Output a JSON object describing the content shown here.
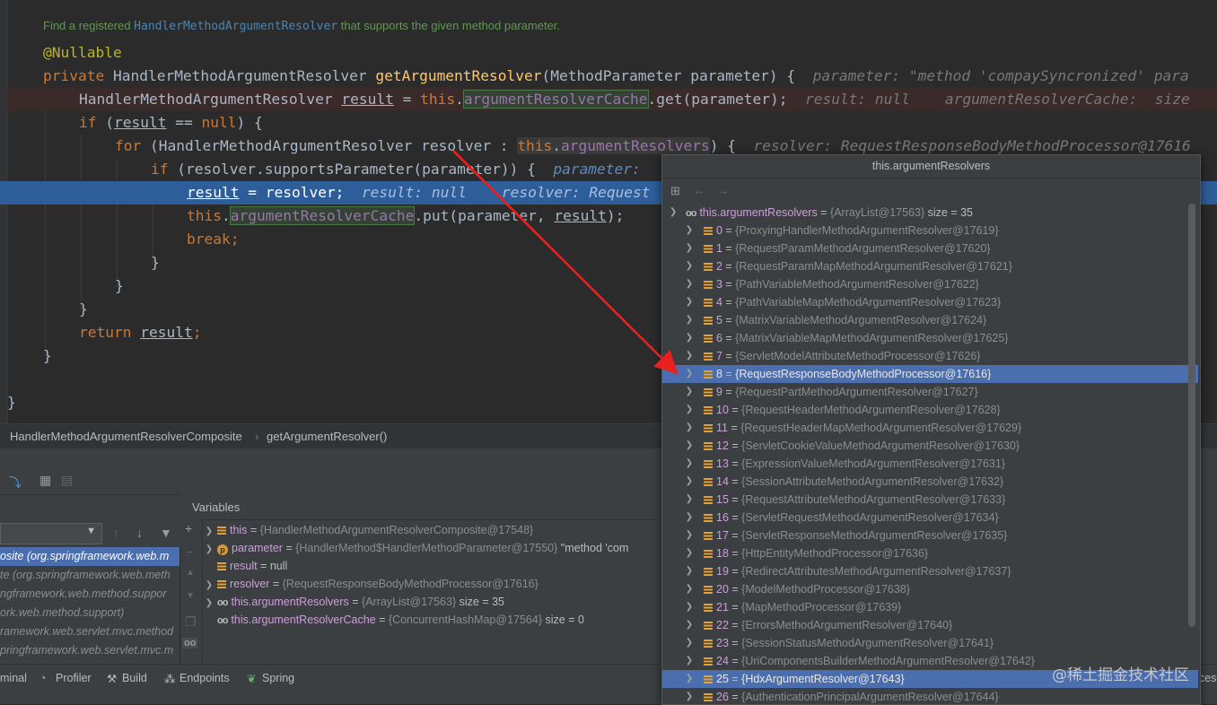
{
  "editor": {
    "doc_prefix": "Find a registered ",
    "doc_ref": "HandlerMethodArgumentResolver",
    "doc_suffix": " that supports the given method parameter.",
    "inline_param": "parameter: \"method 'compaySyncronized' para",
    "inline_result_line": "result: null    argumentResolverCache:  size",
    "inline_resolver": "resolver: RequestResponseBodyMethodProcessor@17616",
    "inline_param2": "parameter: ",
    "inline_cur": "result: null    resolver: Request"
  },
  "breadcrumb": {
    "class_name": "HandlerMethodArgumentResolverComposite",
    "method_name": "getArgumentResolver()"
  },
  "debugger": {
    "variables_title": "Variables",
    "frames": [
      "osite (org.springframework.web.m",
      "te (org.springframework.web.meth",
      "ngframework.web.method.suppor",
      "ork.web.method.support)",
      "ramework.web.servlet.mvc.method",
      "pringframework.web.servlet.mvc.m"
    ],
    "variables": [
      {
        "name": "this",
        "value": "{HandlerMethodArgumentResolverComposite@17548}",
        "extra": ""
      },
      {
        "name": "parameter",
        "value": "{HandlerMethod$HandlerMethodParameter@17550}",
        "extra": "\"method 'com"
      },
      {
        "name": "result",
        "value": "null",
        "extra": ""
      },
      {
        "name": "resolver",
        "value": "{RequestResponseBodyMethodProcessor@17616}",
        "extra": ""
      },
      {
        "name": "this.argumentResolvers",
        "value": "{ArrayList@17563}",
        "extra": "size = 35"
      },
      {
        "name": "this.argumentResolverCache",
        "value": "{ConcurrentHashMap@17564}",
        "extra": "size = 0"
      }
    ]
  },
  "popup": {
    "title": "this.argumentResolvers",
    "root_name": "this.argumentResolvers",
    "root_value": "{ArrayList@17563}",
    "root_size": "size = 35",
    "items": [
      {
        "idx": "0",
        "value": "{ProxyingHandlerMethodArgumentResolver@17619}"
      },
      {
        "idx": "1",
        "value": "{RequestParamMethodArgumentResolver@17620}"
      },
      {
        "idx": "2",
        "value": "{RequestParamMapMethodArgumentResolver@17621}"
      },
      {
        "idx": "3",
        "value": "{PathVariableMethodArgumentResolver@17622}"
      },
      {
        "idx": "4",
        "value": "{PathVariableMapMethodArgumentResolver@17623}"
      },
      {
        "idx": "5",
        "value": "{MatrixVariableMethodArgumentResolver@17624}"
      },
      {
        "idx": "6",
        "value": "{MatrixVariableMapMethodArgumentResolver@17625}"
      },
      {
        "idx": "7",
        "value": "{ServletModelAttributeMethodProcessor@17626}"
      },
      {
        "idx": "8",
        "value": "{RequestResponseBodyMethodProcessor@17616}"
      },
      {
        "idx": "9",
        "value": "{RequestPartMethodArgumentResolver@17627}"
      },
      {
        "idx": "10",
        "value": "{RequestHeaderMethodArgumentResolver@17628}"
      },
      {
        "idx": "11",
        "value": "{RequestHeaderMapMethodArgumentResolver@17629}"
      },
      {
        "idx": "12",
        "value": "{ServletCookieValueMethodArgumentResolver@17630}"
      },
      {
        "idx": "13",
        "value": "{ExpressionValueMethodArgumentResolver@17631}"
      },
      {
        "idx": "14",
        "value": "{SessionAttributeMethodArgumentResolver@17632}"
      },
      {
        "idx": "15",
        "value": "{RequestAttributeMethodArgumentResolver@17633}"
      },
      {
        "idx": "16",
        "value": "{ServletRequestMethodArgumentResolver@17634}"
      },
      {
        "idx": "17",
        "value": "{ServletResponseMethodArgumentResolver@17635}"
      },
      {
        "idx": "18",
        "value": "{HttpEntityMethodProcessor@17636}"
      },
      {
        "idx": "19",
        "value": "{RedirectAttributesMethodArgumentResolver@17637}"
      },
      {
        "idx": "20",
        "value": "{ModelMethodProcessor@17638}"
      },
      {
        "idx": "21",
        "value": "{MapMethodProcessor@17639}"
      },
      {
        "idx": "22",
        "value": "{ErrorsMethodArgumentResolver@17640}"
      },
      {
        "idx": "23",
        "value": "{SessionStatusMethodArgumentResolver@17641}"
      },
      {
        "idx": "24",
        "value": "{UriComponentsBuilderMethodArgumentResolver@17642}"
      },
      {
        "idx": "25",
        "value": "{HdxArgumentResolver@17643}"
      },
      {
        "idx": "26",
        "value": "{AuthenticationPrincipalArgumentResolver@17644}"
      }
    ],
    "selected": [
      "8",
      "25"
    ]
  },
  "statusbar": {
    "terminal": "minal",
    "profiler": "Profiler",
    "build": "Build",
    "endpoints": "Endpoints",
    "spring": "Spring",
    "right_text": "ces"
  },
  "watermark": "@稀土掘金技术社区",
  "colors": {
    "keyword": "#cc7832",
    "method": "#ffc66d",
    "field": "#9876aa",
    "selection": "#4b6eaf",
    "current_line": "#2d5e9a",
    "annotation_arrow": "#e8201e"
  }
}
